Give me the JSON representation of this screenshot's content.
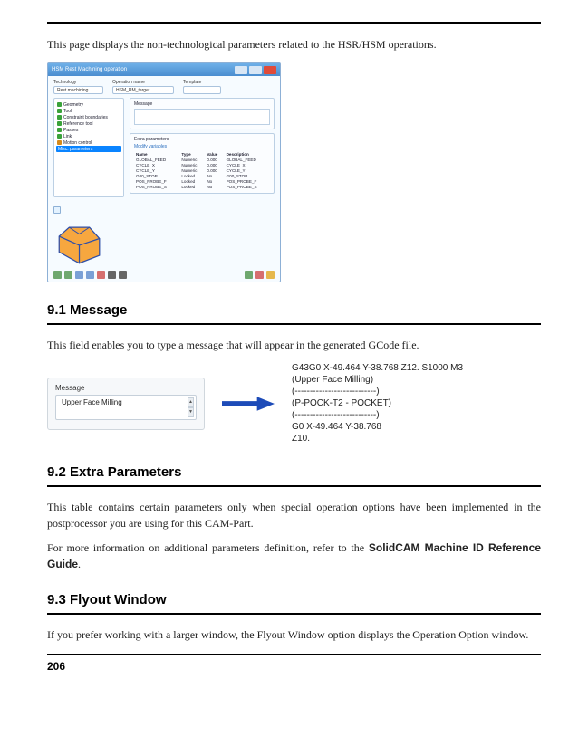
{
  "intro": "This page displays the non-technological parameters related to the HSR/HSM operations.",
  "dialog": {
    "title": "HSM Rest Machining operation",
    "toprow": {
      "technology_label": "Technology",
      "technology_value": "Rest machining",
      "operation_label": "Operation name",
      "operation_value": "HSM_RM_target",
      "template_label": "Template"
    },
    "tree": {
      "items": [
        {
          "label": "Geometry",
          "color": "#3aa23a"
        },
        {
          "label": "Tool",
          "color": "#3aa23a"
        },
        {
          "label": "Constraint boundaries",
          "color": "#3aa23a"
        },
        {
          "label": "Reference tool",
          "color": "#3aa23a"
        },
        {
          "label": "Passes",
          "color": "#3aa23a"
        },
        {
          "label": "Link",
          "color": "#3aa23a"
        },
        {
          "label": "Motion control",
          "color": "#d68a1a"
        }
      ],
      "selected_label": "Misc. parameters"
    },
    "message_group_title": "Message",
    "extra_group_title": "Extra parameters",
    "extra_link": "Modify variables",
    "table": {
      "headers": [
        "Name",
        "Type",
        "Value",
        "Description"
      ],
      "rows": [
        [
          "GLOBAL_FEED",
          "Numeric",
          "0.000",
          "GLOBAL_FEED"
        ],
        [
          "CYCLE_X",
          "Numeric",
          "0.000",
          "CYCLE_X"
        ],
        [
          "CYCLE_Y",
          "Numeric",
          "0.000",
          "CYCLE_Y"
        ],
        [
          "G00_STOP",
          "Locked",
          "No",
          "G00_STOP"
        ],
        [
          "POS_PROBE_F",
          "Locked",
          "No",
          "POS_PROBE_F"
        ],
        [
          "POS_PROBE_S",
          "Locked",
          "No",
          "POS_PROBE_S"
        ]
      ]
    }
  },
  "section1": {
    "heading": "9.1   Message",
    "body": "This field enables you to type a message that will appear in the generated GCode file.",
    "panel_label": "Message",
    "panel_value": "Upper Face Milling",
    "gcode": [
      "G43G0 X-49.464 Y-38.768 Z12. S1000 M3",
      "(Upper Face Milling)",
      "(---------------------------)",
      "(P-POCK-T2 - POCKET)",
      "(---------------------------)",
      "G0 X-49.464 Y-38.768",
      "Z10."
    ]
  },
  "section2": {
    "heading": "9.2   Extra Parameters",
    "body1": "This table contains certain parameters  only when special operation options have been implemented in the postprocessor you are using for this CAM-Part.",
    "body2_prefix": "For more information on additional parameters definition, refer to the ",
    "body2_bold": "SolidCAM Machine ID Reference Guide",
    "body2_suffix": "."
  },
  "section3": {
    "heading": "9.3   Flyout Window",
    "body": "If you prefer working with a larger window, the Flyout Window option displays the Operation Option window."
  },
  "page_number": "206"
}
